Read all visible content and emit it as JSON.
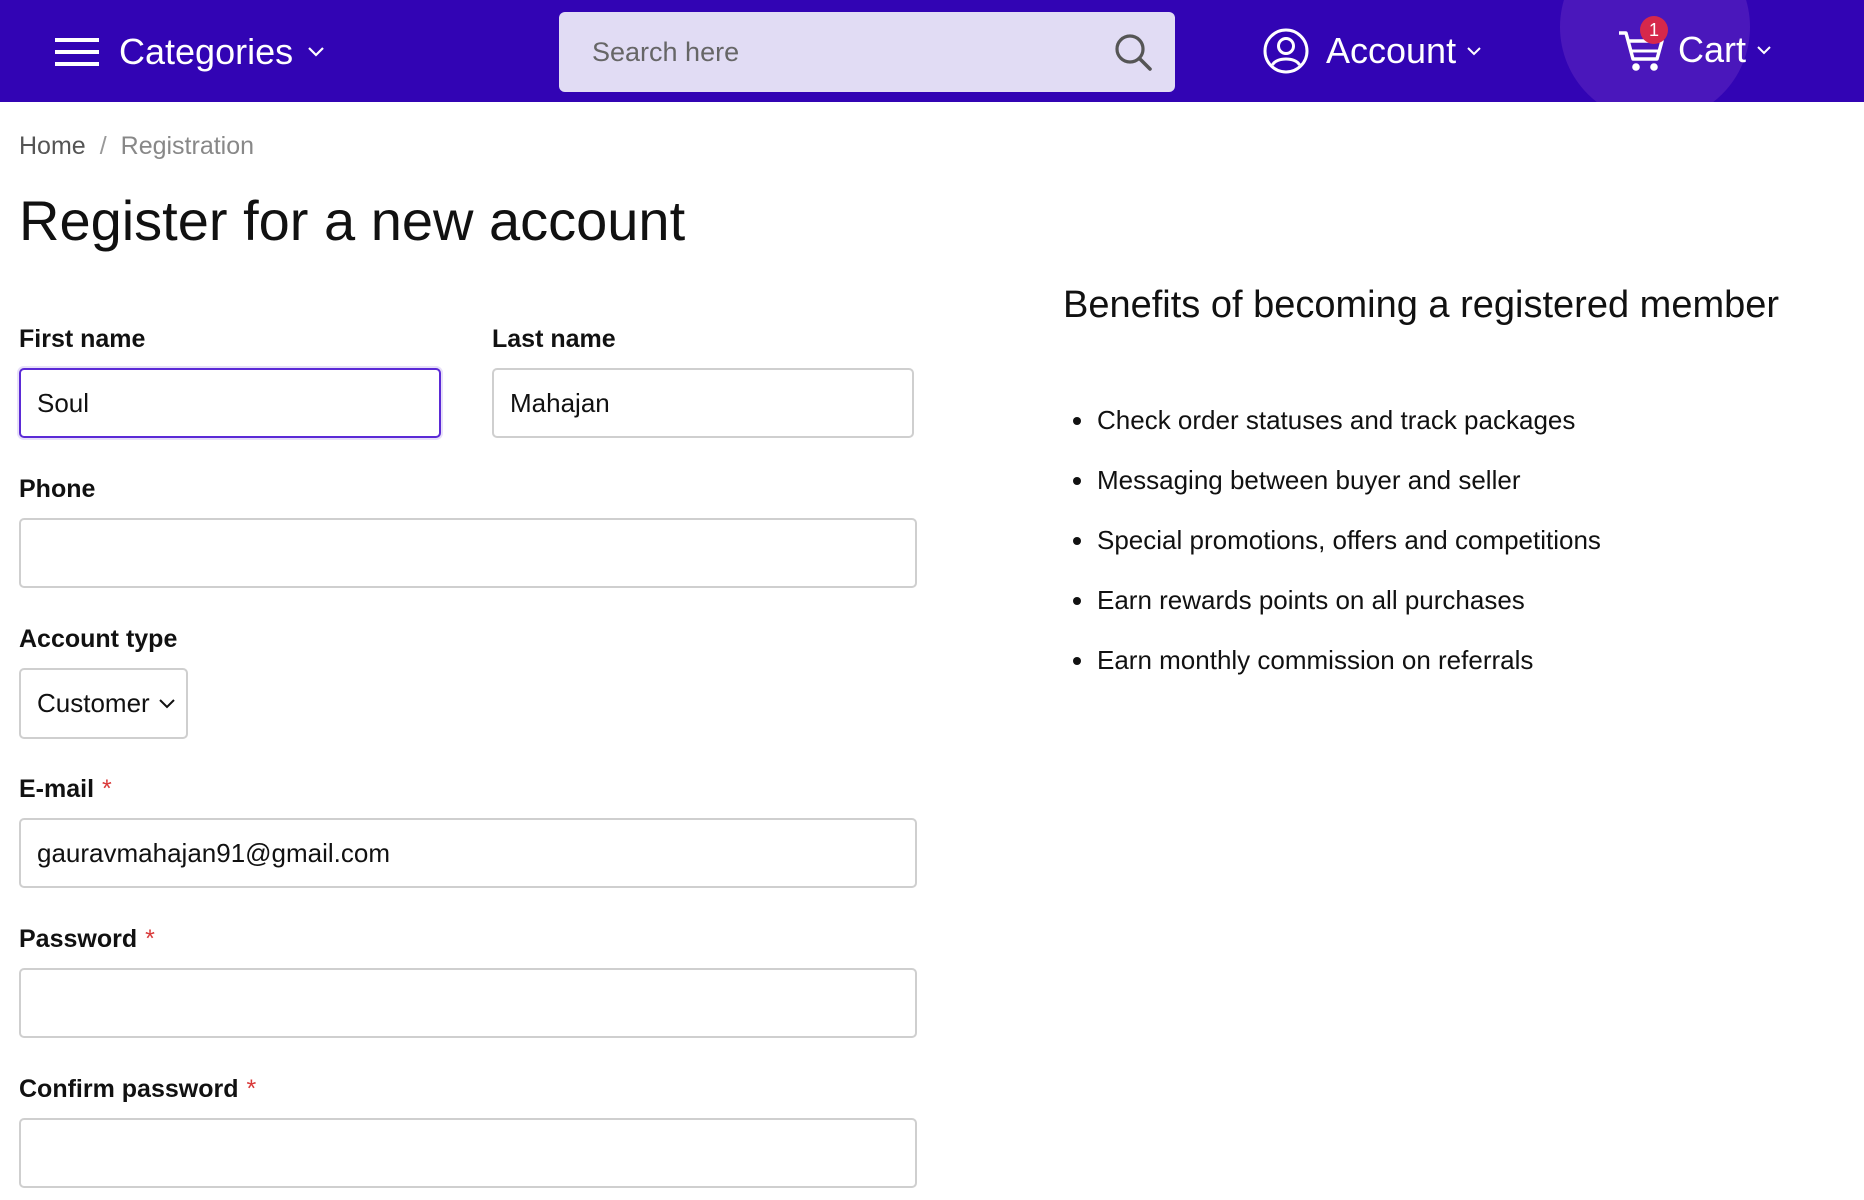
{
  "header": {
    "categories_label": "Categories",
    "search_placeholder": "Search here",
    "account_label": "Account",
    "cart_label": "Cart",
    "cart_count": "1",
    "brand_color": "#3204b4"
  },
  "breadcrumb": {
    "home": "Home",
    "separator": "/",
    "current": "Registration"
  },
  "page": {
    "title": "Register for a new account"
  },
  "form": {
    "first_name": {
      "label": "First name",
      "value": "Soul"
    },
    "last_name": {
      "label": "Last name",
      "value": "Mahajan"
    },
    "phone": {
      "label": "Phone",
      "value": ""
    },
    "account_type": {
      "label": "Account type",
      "selected": "Customer"
    },
    "email": {
      "label": "E-mail",
      "required_mark": "*",
      "value": "gauravmahajan91@gmail.com"
    },
    "password": {
      "label": "Password",
      "required_mark": "*",
      "value": ""
    },
    "confirm_password": {
      "label": "Confirm password",
      "required_mark": "*",
      "value": ""
    }
  },
  "benefits": {
    "title": "Benefits of becoming a registered member",
    "items": [
      "Check order statuses and track packages",
      "Messaging between buyer and seller",
      "Special promotions, offers and competitions",
      "Earn rewards points on all purchases",
      "Earn monthly commission on referrals"
    ]
  }
}
